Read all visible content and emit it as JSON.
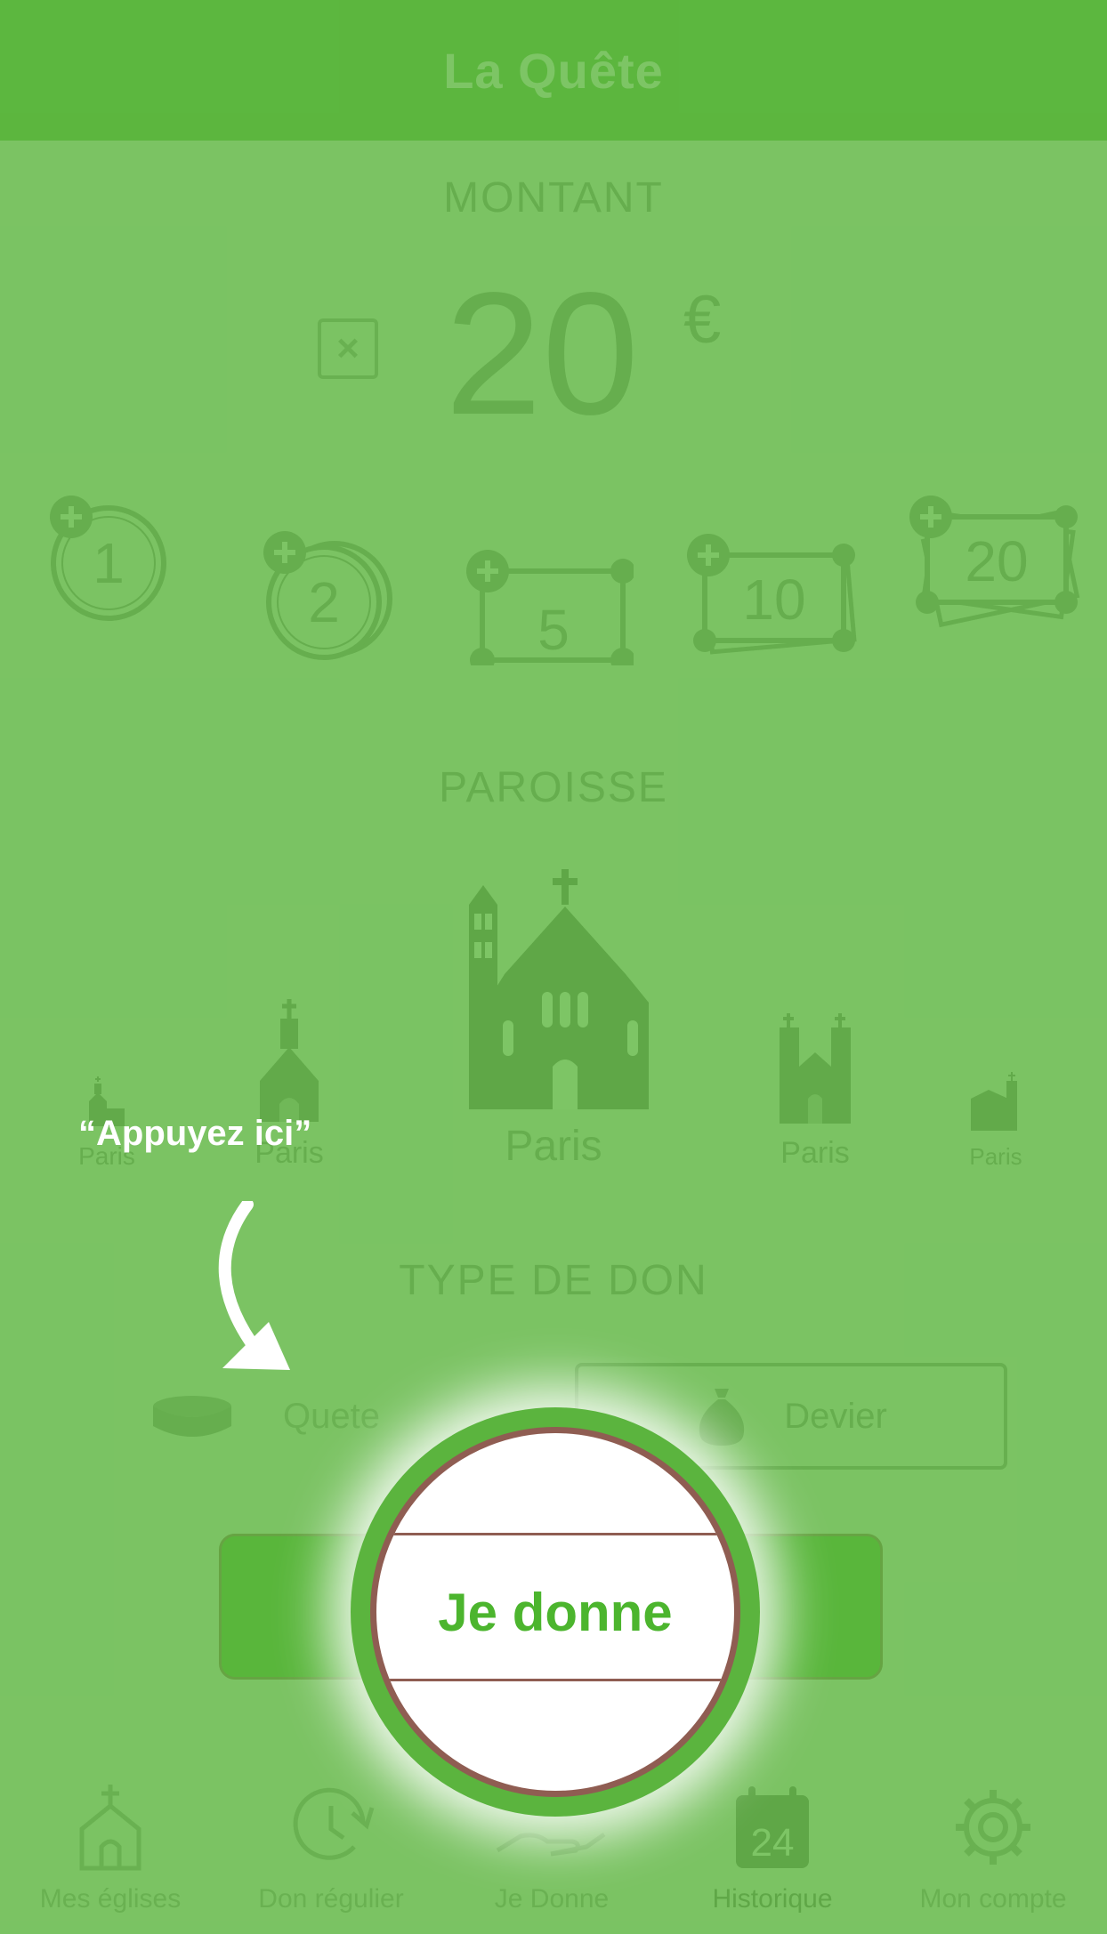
{
  "app": {
    "title": "La Quête"
  },
  "amount": {
    "section_title": "MONTANT",
    "value": "20",
    "currency": "€"
  },
  "quick_add": [
    {
      "kind": "coin",
      "value": "1"
    },
    {
      "kind": "coins",
      "value": "2"
    },
    {
      "kind": "note",
      "value": "5"
    },
    {
      "kind": "notes",
      "value": "10"
    },
    {
      "kind": "notes-stack",
      "value": "20"
    }
  ],
  "parish": {
    "section_title": "PAROISSE",
    "items": [
      {
        "label": "Paris"
      },
      {
        "label": "Paris"
      },
      {
        "label": "Paris",
        "selected": true
      },
      {
        "label": "Paris"
      },
      {
        "label": "Paris"
      }
    ]
  },
  "donation_type": {
    "section_title": "TYPE DE DON",
    "options": [
      {
        "label": "Quete",
        "icon": "coin-stack-icon"
      },
      {
        "label": "Devier",
        "icon": "money-bag-icon"
      }
    ]
  },
  "give_button": {
    "label": "Je donne"
  },
  "tabs": [
    {
      "label": "Mes églises",
      "icon": "church-icon"
    },
    {
      "label": "Don régulier",
      "icon": "recurring-clock-icon"
    },
    {
      "label": "Je Donne",
      "icon": "give-hand-icon"
    },
    {
      "label": "Historique",
      "icon": "calendar-icon",
      "icon_text": "24",
      "active": true
    },
    {
      "label": "Mon compte",
      "icon": "gear-icon"
    }
  ],
  "hint": {
    "text": "“Appuyez ici”"
  },
  "colors": {
    "brand": "#5db53f",
    "overlay": "#5cb73f",
    "button": "#4cb52e",
    "spotlight_border": "#8f5d52"
  }
}
